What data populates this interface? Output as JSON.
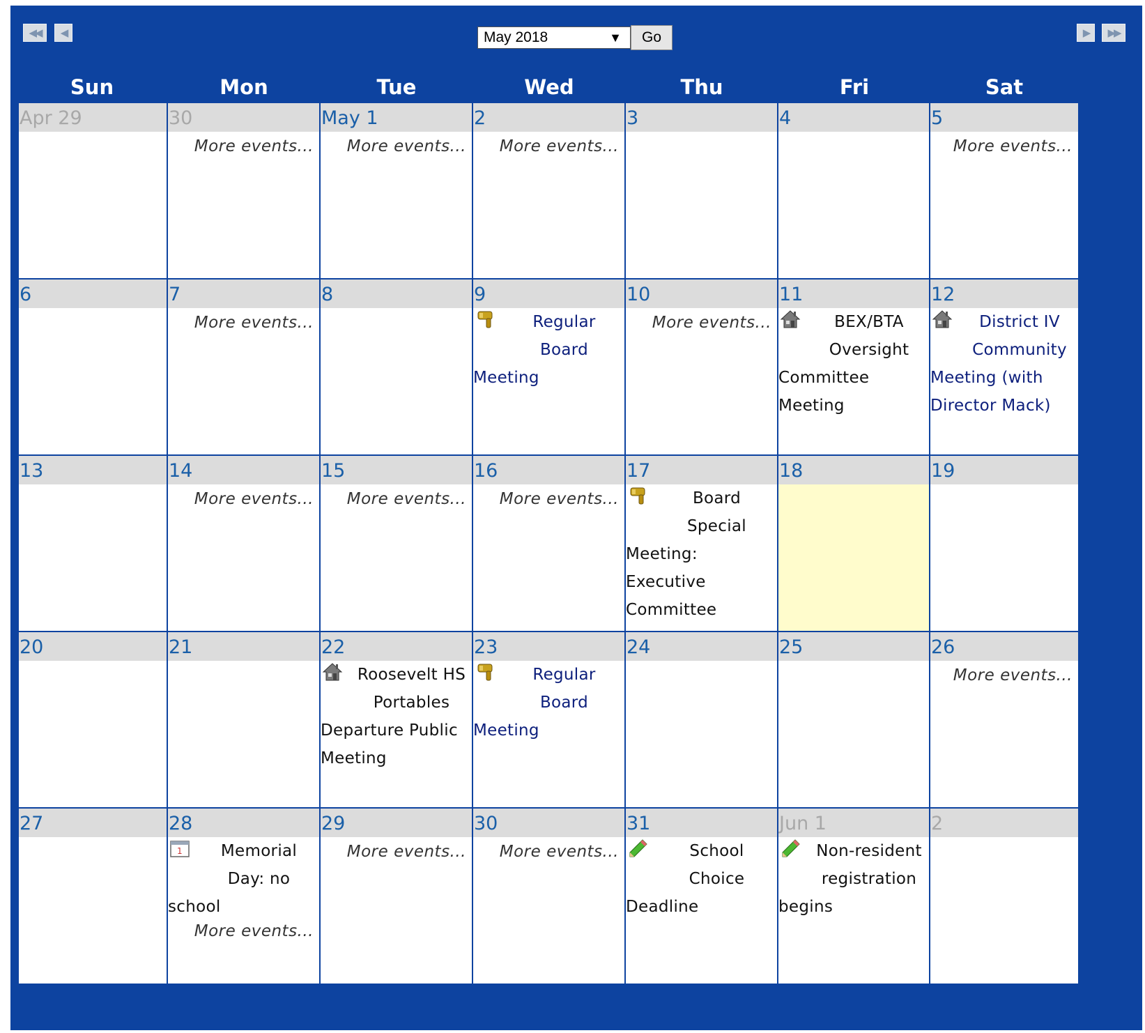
{
  "nav": {
    "month_value": "May 2018",
    "go_label": "Go",
    "first_label": "◀◀",
    "prev_label": "◀",
    "next_label": "▶",
    "last_label": "▶▶"
  },
  "days_of_week": [
    "Sun",
    "Mon",
    "Tue",
    "Wed",
    "Thu",
    "Fri",
    "Sat"
  ],
  "more_label": "More events...",
  "colors": {
    "frame": "#0d43a0",
    "header_band": "#dcdcdc",
    "date_blue": "#1a5fa8",
    "today": "#fffccc",
    "event_blue": "#0d1f7c"
  },
  "weeks": [
    [
      {
        "label": "Apr 29",
        "other": true
      },
      {
        "label": "30",
        "other": true,
        "more": true
      },
      {
        "label": "May 1",
        "more": true
      },
      {
        "label": "2",
        "more": true
      },
      {
        "label": "3"
      },
      {
        "label": "4"
      },
      {
        "label": "5",
        "more": true
      }
    ],
    [
      {
        "label": "6"
      },
      {
        "label": "7",
        "more": true
      },
      {
        "label": "8"
      },
      {
        "label": "9",
        "event": {
          "icon": "gavel-icon",
          "color": "blue",
          "lines": [
            "Regular",
            "Board",
            "Meeting"
          ]
        }
      },
      {
        "label": "10",
        "more": true
      },
      {
        "label": "11",
        "event": {
          "icon": "house-icon",
          "color": "black",
          "lines": [
            "BEX/BTA",
            "Oversight",
            "Committee",
            "Meeting"
          ]
        }
      },
      {
        "label": "12",
        "event": {
          "icon": "house-icon",
          "color": "blue",
          "lines": [
            "District IV",
            "Community",
            "Meeting (with",
            "Director Mack)"
          ]
        }
      }
    ],
    [
      {
        "label": "13"
      },
      {
        "label": "14",
        "more": true
      },
      {
        "label": "15",
        "more": true
      },
      {
        "label": "16",
        "more": true
      },
      {
        "label": "17",
        "event": {
          "icon": "gavel-icon",
          "color": "black",
          "lines": [
            "Board",
            "Special",
            "Meeting:",
            "Executive",
            "Committee"
          ]
        }
      },
      {
        "label": "18",
        "today": true
      },
      {
        "label": "19"
      }
    ],
    [
      {
        "label": "20"
      },
      {
        "label": "21"
      },
      {
        "label": "22",
        "event": {
          "icon": "house-icon",
          "color": "black",
          "lines": [
            "Roosevelt HS",
            "Portables",
            "Departure Public",
            "Meeting"
          ]
        }
      },
      {
        "label": "23",
        "event": {
          "icon": "gavel-icon",
          "color": "blue",
          "lines": [
            "Regular",
            "Board",
            "Meeting"
          ]
        }
      },
      {
        "label": "24"
      },
      {
        "label": "25"
      },
      {
        "label": "26",
        "more": true
      }
    ],
    [
      {
        "label": "27"
      },
      {
        "label": "28",
        "event": {
          "icon": "calendar-icon",
          "color": "black",
          "lines": [
            "Memorial",
            "Day: no",
            "school"
          ]
        },
        "more": true
      },
      {
        "label": "29",
        "more": true
      },
      {
        "label": "30",
        "more": true
      },
      {
        "label": "31",
        "event": {
          "icon": "pencil-icon",
          "color": "black",
          "lines": [
            "School",
            "Choice",
            "Deadline"
          ]
        }
      },
      {
        "label": "Jun 1",
        "other": true,
        "event": {
          "icon": "pencil-icon",
          "color": "black",
          "lines": [
            "Non-resident",
            "registration",
            "begins"
          ]
        }
      },
      {
        "label": "2",
        "other": true
      }
    ]
  ]
}
